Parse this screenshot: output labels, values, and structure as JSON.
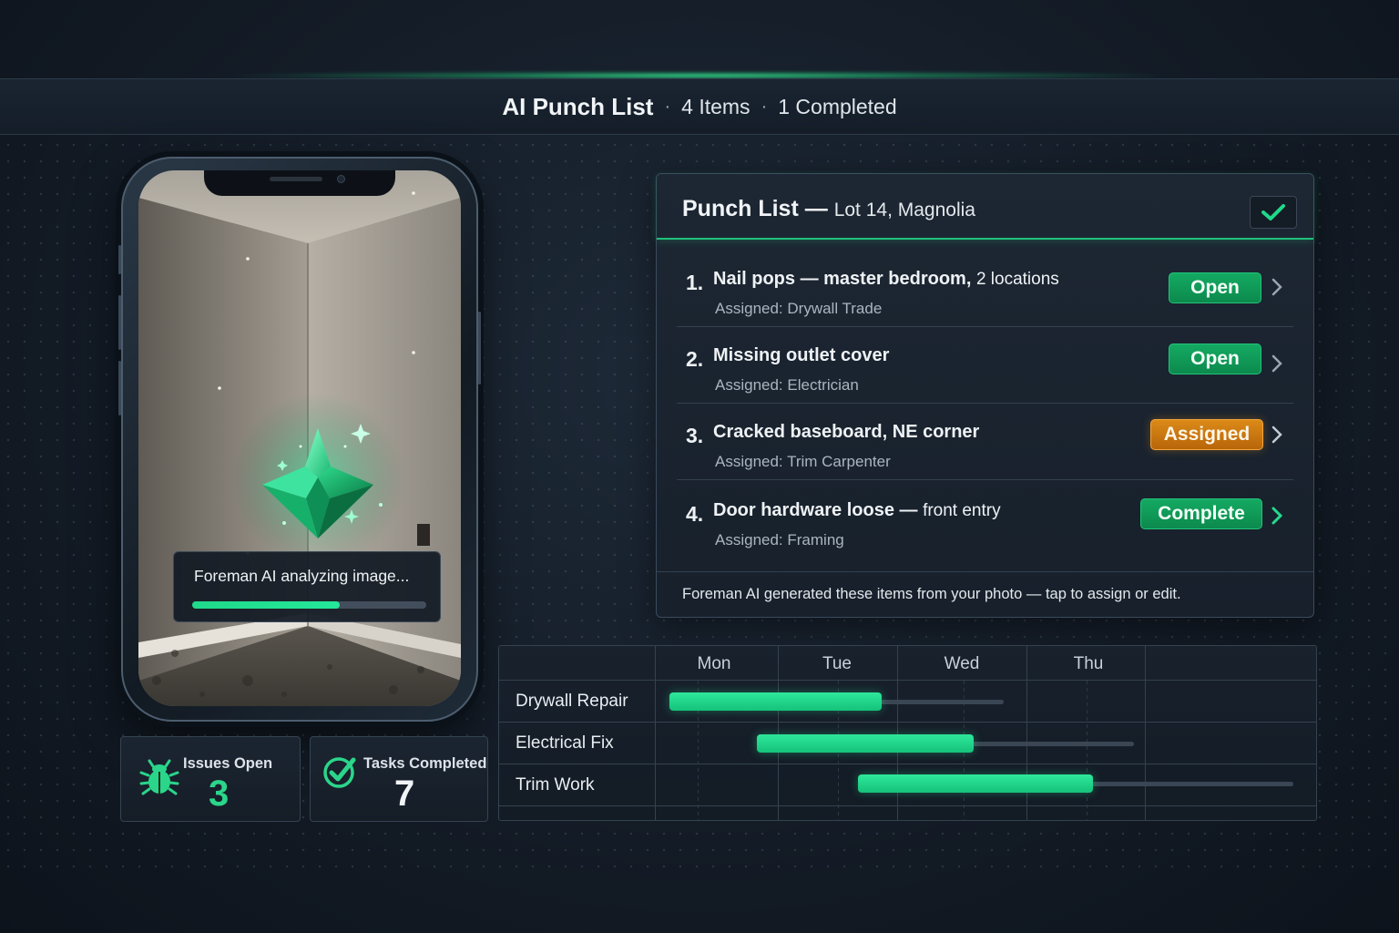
{
  "header": {
    "title": "AI Punch List",
    "items": "4 Items",
    "completed": "1 Completed",
    "separator": "·"
  },
  "phone": {
    "status_text": "Foreman AI analyzing image...",
    "progress": 0.63,
    "accent_color": "#1fd98a"
  },
  "stats": [
    {
      "label": "Issues Open",
      "value": "3",
      "icon": "bug-icon",
      "color": "#2bd58a"
    },
    {
      "label": "Tasks Completed",
      "value": "7",
      "icon": "check-circle-icon",
      "color": "#f1f4f7"
    }
  ],
  "punch_list": {
    "title": "Punch List",
    "dash": "—",
    "location": "Lot 14, Magnolia",
    "items": [
      {
        "num": "1.",
        "name": "Nail pops — master bedroom,",
        "name_detail": "2 locations",
        "assigned": "Assigned: Drywall Trade",
        "status": "Open",
        "status_type": "open"
      },
      {
        "num": "2.",
        "name": "Missing outlet cover",
        "name_detail": "",
        "assigned": "Assigned: Electrician",
        "status": "Open",
        "status_type": "open"
      },
      {
        "num": "3.",
        "name": "Cracked baseboard, NE corner",
        "name_detail": "",
        "assigned": "Assigned: Trim Carpenter",
        "status": "Assigned",
        "status_type": "assigned"
      },
      {
        "num": "4.",
        "name": "Door hardware loose —",
        "name_detail": "front entry",
        "assigned": "Assigned: Framing",
        "status": "Complete",
        "status_type": "complete"
      }
    ],
    "footer": "Foreman AI generated these items from your photo — tap to assign or edit."
  },
  "schedule": {
    "days": [
      "Mon",
      "Tue",
      "Wed",
      "Thu"
    ],
    "tasks": [
      {
        "name": "Drywall Repair"
      },
      {
        "name": "Electrical Fix"
      },
      {
        "name": "Trim Work"
      }
    ]
  },
  "colors": {
    "accent_green": "#1fd98a",
    "status_open": "#0f9a58",
    "status_assigned": "#cc7812",
    "background": "#141c27"
  }
}
